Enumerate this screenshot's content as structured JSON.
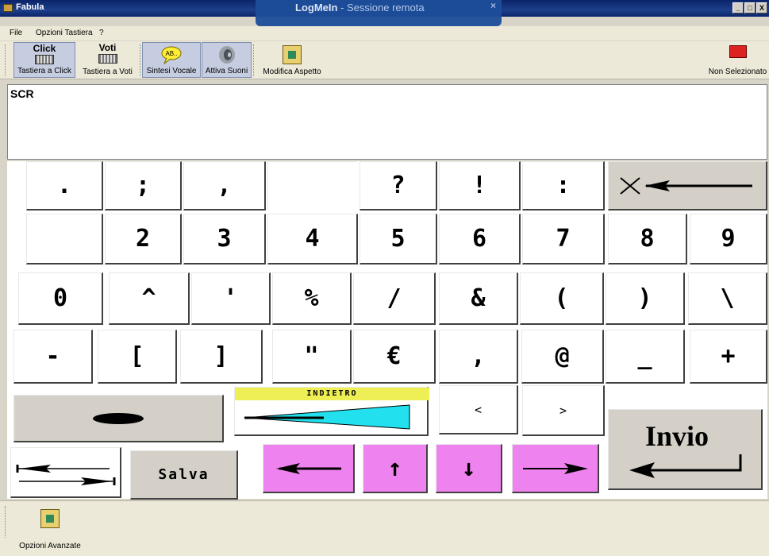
{
  "window": {
    "title": "Fabula",
    "remote_title": "LogMeIn",
    "remote_sub": "Sessione remota",
    "minimize": "_",
    "maximize": "□",
    "close": "X"
  },
  "menu": {
    "items": [
      "File",
      "Opzioni Tastiera",
      "?"
    ]
  },
  "toolbar": {
    "click_top": "Click",
    "click_label": "Tastiera a Click",
    "voti_top": "Voti",
    "voti_label": "Tastiera a Voti",
    "speech_label": "Sintesi Vocale",
    "speech_bubble": "AB..",
    "sound_label": "Attiva Suoni",
    "appearance_label": "Modifica Aspetto",
    "status_label": "Non Selezionato"
  },
  "editor": {
    "text": "SCR"
  },
  "keys": {
    "row1": [
      ".",
      ";",
      ",",
      "",
      "?",
      "!",
      ":"
    ],
    "row2": [
      "",
      "2",
      "3",
      "4",
      "5",
      "6",
      "7",
      "8",
      "9"
    ],
    "row3": [
      "0",
      "^",
      "'",
      "%",
      "/",
      "&",
      "(",
      ")",
      "\\"
    ],
    "row4": [
      "-",
      "[",
      "]",
      "\"",
      "€",
      ",",
      "@",
      "_",
      "+"
    ],
    "back_label": "INDIETRO",
    "lt": "<",
    "gt": ">",
    "enter": "Invio",
    "save": "Salva",
    "up": "↑",
    "down": "↓"
  },
  "bottom": {
    "advanced_label": "Opzioni Avanzate"
  }
}
